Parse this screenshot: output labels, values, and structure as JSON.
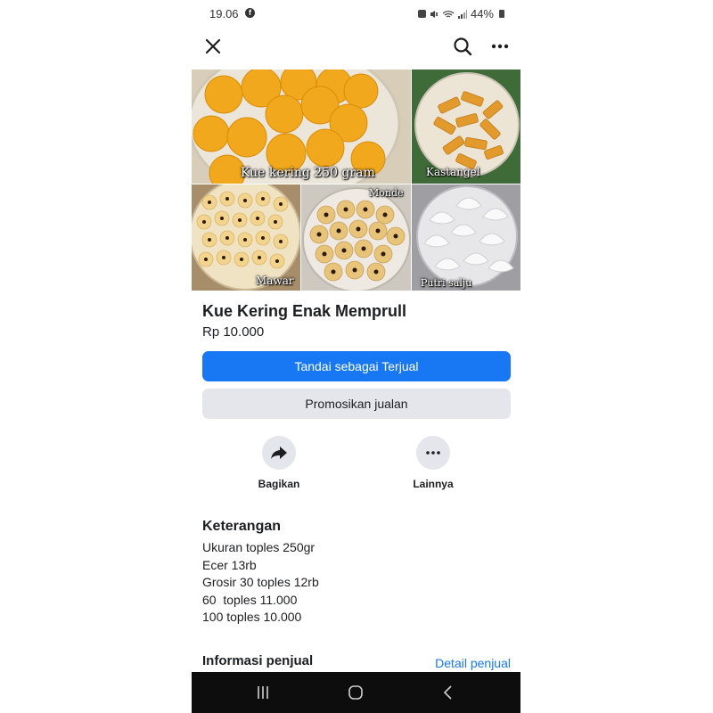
{
  "status_bar": {
    "time": "19.06",
    "battery": "44%"
  },
  "icons": {
    "close": "close-icon",
    "search": "search-icon",
    "more": "more-icon",
    "share": "share-icon",
    "other": "more-horizontal-icon"
  },
  "photos": [
    {
      "label": "Kue kering 250 gram"
    },
    {
      "label": "Kastangel"
    },
    {
      "label": "Mawar"
    },
    {
      "label": "Monde"
    },
    {
      "label": "Putri salju"
    }
  ],
  "listing": {
    "title": "Kue Kering Enak Memprull",
    "price": "Rp 10.000"
  },
  "buttons": {
    "mark_sold": "Tandai sebagai Terjual",
    "promote": "Promosikan jualan"
  },
  "actions": {
    "share": "Bagikan",
    "other": "Lainnya"
  },
  "description": {
    "heading": "Keterangan",
    "lines": [
      "Ukuran toples 250gr",
      "Ecer 13rb",
      "Grosir 30 toples 12rb",
      "60  toples 11.000",
      "100 toples 10.000"
    ]
  },
  "seller": {
    "heading": "Informasi penjual",
    "link": "Detail penjual"
  },
  "colors": {
    "accent": "#1877f2",
    "secondary_button": "#e4e6eb",
    "text": "#1c1e21",
    "nav_bar": "#0d0d0d"
  }
}
